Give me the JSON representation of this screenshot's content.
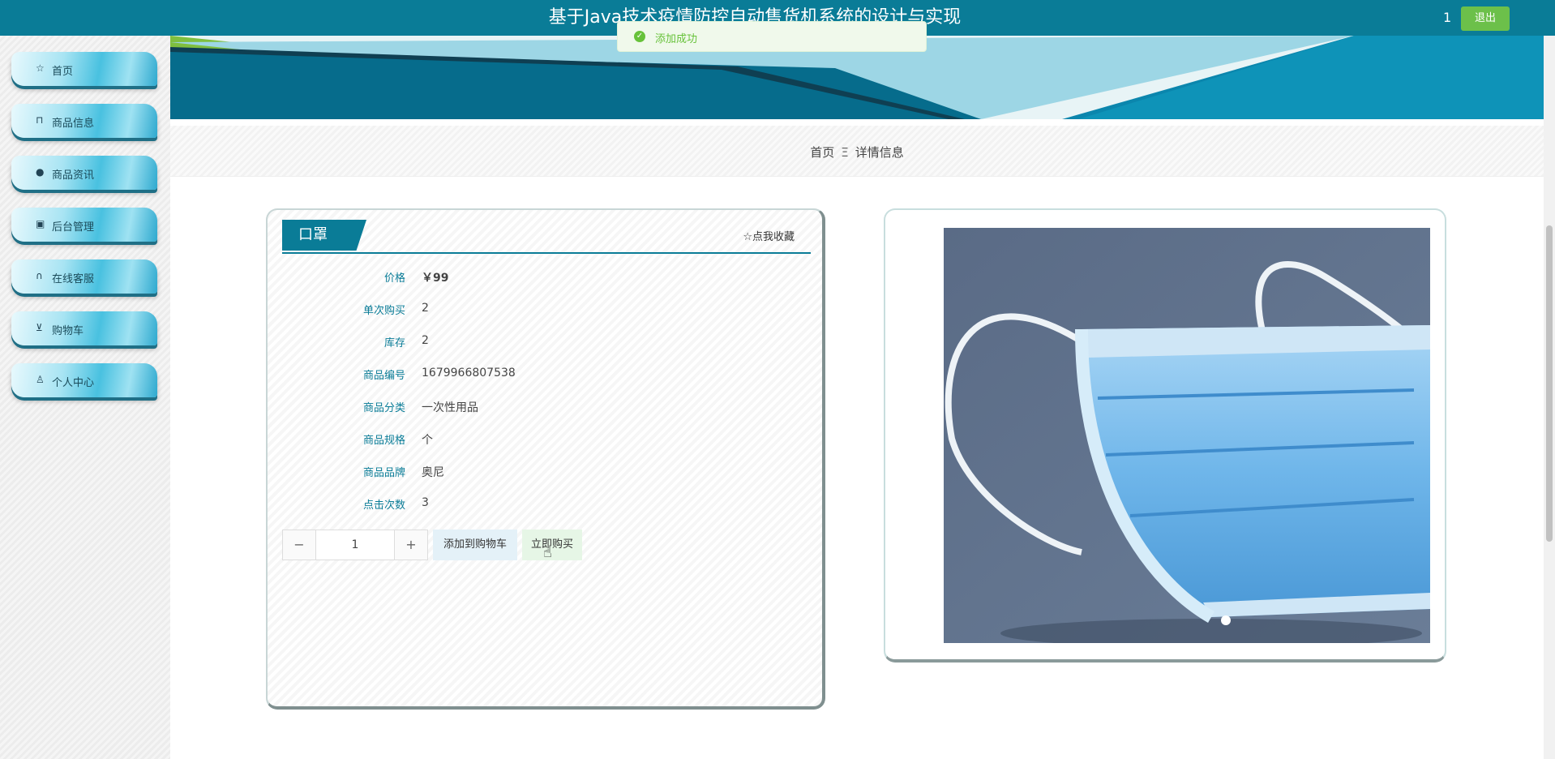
{
  "header": {
    "title": "基于Java技术疫情防控自动售货机系统的设计与实现",
    "user": "1",
    "logout_label": "退出"
  },
  "toast": {
    "message": "添加成功"
  },
  "sidebar": {
    "items": [
      {
        "label": "首页",
        "icon": "star-icon"
      },
      {
        "label": "商品信息",
        "icon": "bag-icon"
      },
      {
        "label": "商品资讯",
        "icon": "info-icon"
      },
      {
        "label": "后台管理",
        "icon": "box-icon"
      },
      {
        "label": "在线客服",
        "icon": "headset-icon"
      },
      {
        "label": "购物车",
        "icon": "cart-icon"
      },
      {
        "label": "个人中心",
        "icon": "user-icon"
      }
    ]
  },
  "breadcrumb": {
    "home": "首页",
    "separator": "Ξ",
    "current": "详情信息"
  },
  "product": {
    "name": "口罩",
    "favorite_label": "☆点我收藏",
    "fields": [
      {
        "label": "价格",
        "value": "￥99"
      },
      {
        "label": "单次购买",
        "value": "2"
      },
      {
        "label": "库存",
        "value": "2"
      },
      {
        "label": "商品编号",
        "value": "1679966807538"
      },
      {
        "label": "商品分类",
        "value": "一次性用品"
      },
      {
        "label": "商品规格",
        "value": "个"
      },
      {
        "label": "商品品牌",
        "value": "奥尼"
      },
      {
        "label": "点击次数",
        "value": "3"
      }
    ],
    "quantity": "1",
    "add_to_cart_label": "添加到购物车",
    "buy_now_label": "立即购买"
  },
  "colors": {
    "primary": "#0a7c97",
    "success": "#67c23a",
    "logout": "#6cc04a"
  }
}
